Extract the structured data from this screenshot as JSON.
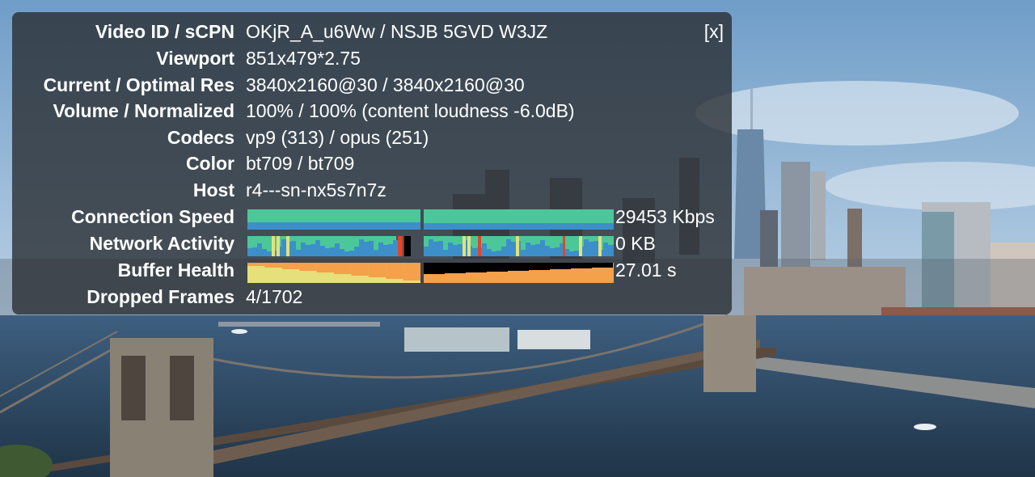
{
  "stats": {
    "close_label": "[x]",
    "rows": [
      {
        "label": "Video ID / sCPN",
        "value": "OKjR_A_u6Ww / NSJB 5GVD W3JZ"
      },
      {
        "label": "Viewport",
        "value": "851x479*2.75"
      },
      {
        "label": "Current / Optimal Res",
        "value": "3840x2160@30 / 3840x2160@30"
      },
      {
        "label": "Volume / Normalized",
        "value": "100% / 100% (content loudness -6.0dB)"
      },
      {
        "label": "Codecs",
        "value": "vp9 (313) / opus (251)"
      },
      {
        "label": "Color",
        "value": "bt709 / bt709"
      },
      {
        "label": "Host",
        "value": "r4---sn-nx5s7n7z"
      },
      {
        "label": "Connection Speed",
        "value": "29453 Kbps"
      },
      {
        "label": "Network Activity",
        "value": "0 KB"
      },
      {
        "label": "Buffer Health",
        "value": "27.01 s"
      },
      {
        "label": "Dropped Frames",
        "value": "4/1702"
      }
    ]
  },
  "colors": {
    "panel_bg": "#282c30",
    "graph_green": "#4cc79a",
    "graph_blue": "#3d8fc9",
    "graph_yellow": "#e5e07a",
    "graph_orange": "#f5a04a",
    "graph_red": "#e0462a"
  },
  "video_scene": "new-york-skyline-brooklyn-bridge"
}
